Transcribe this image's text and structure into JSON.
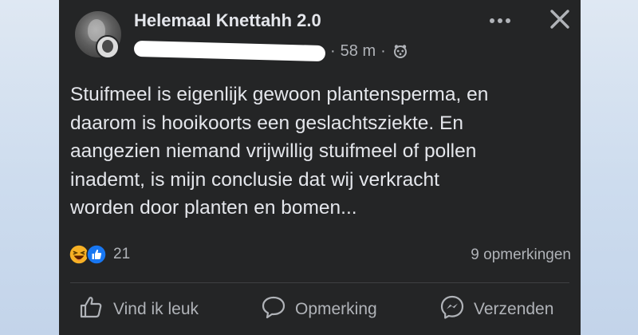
{
  "post": {
    "group_name": "Helemaal Knettahh 2.0",
    "time": "58 m",
    "text": "Stuifmeel is eigenlijk gewoon plantensperma, en\ndaarom is hooikoorts een geslachtsziekte. En\naangezien niemand vrijwillig stuifmeel of pollen\ninademt, is mijn conclusie dat wij verkracht\nworden door planten en bomen...",
    "reaction_count": "21",
    "comment_count": "9 opmerkingen"
  },
  "actions": {
    "like": "Vind ik leuk",
    "comment": "Opmerking",
    "send": "Verzenden"
  },
  "colors": {
    "card_bg": "#242526",
    "text_primary": "#e4e6eb",
    "text_secondary": "#b0b3b8",
    "haha_yellow": "#f7b125",
    "like_blue": "#1877f2"
  },
  "icons": [
    "more-icon",
    "close-icon",
    "audience-icon",
    "haha-reaction-icon",
    "like-reaction-icon",
    "thumbs-up-icon",
    "comment-bubble-icon",
    "messenger-icon"
  ]
}
